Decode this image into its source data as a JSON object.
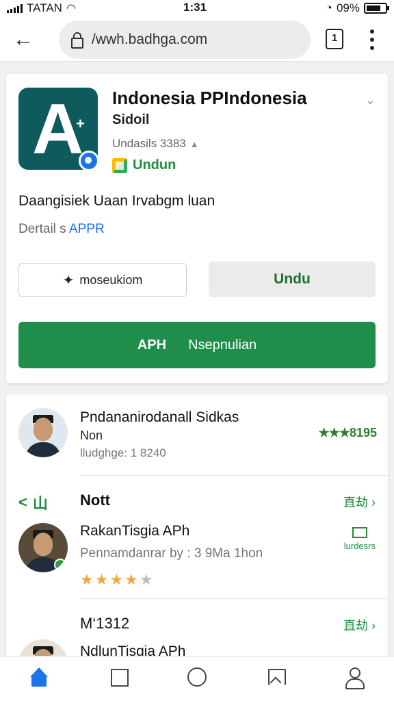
{
  "status_bar": {
    "carrier": "TATAN",
    "time": "1:31",
    "battery": "09%"
  },
  "browser": {
    "url": "/wwh.badhga.com",
    "tab_count": "1"
  },
  "app_card": {
    "title": "Indonesia PPIndonesia",
    "subtitle": "Sidoil",
    "downloads": "Undasils 3383",
    "install_label": "Undun",
    "description": "Daangisiek Uaan Irvabgm luan",
    "details_label": "Dertail s",
    "details_link": "APPR",
    "outline_button": "moseukiom",
    "gray_button": "Undu",
    "apk_label": "APH",
    "green_button": "Nsepnulian"
  },
  "list": {
    "row1": {
      "name": "Pndananirodanall Sidkas",
      "sub": "Non",
      "meta": "lludghge: 1 8240",
      "stars": "★★★",
      "rating": "8195"
    },
    "section1": {
      "icon_label": "<",
      "icon_text": "山",
      "title": "Nott",
      "more": "直劫"
    },
    "row2": {
      "name": "RakanTisgia APh",
      "meta": "Pennamdanrar by : 3 9Ma 1hon",
      "stars": "★★★★",
      "stars_dim": "★",
      "side": "lurdesrs"
    },
    "section2": {
      "title": "M‘1312",
      "more": "直劫"
    },
    "row3": {
      "name": "NdlunTisgia APh"
    }
  },
  "colors": {
    "brand_green": "#1e8e4a",
    "link_blue": "#1a73e8",
    "app_icon_bg": "#0f5a5c",
    "star_gold": "#f2a93b"
  }
}
